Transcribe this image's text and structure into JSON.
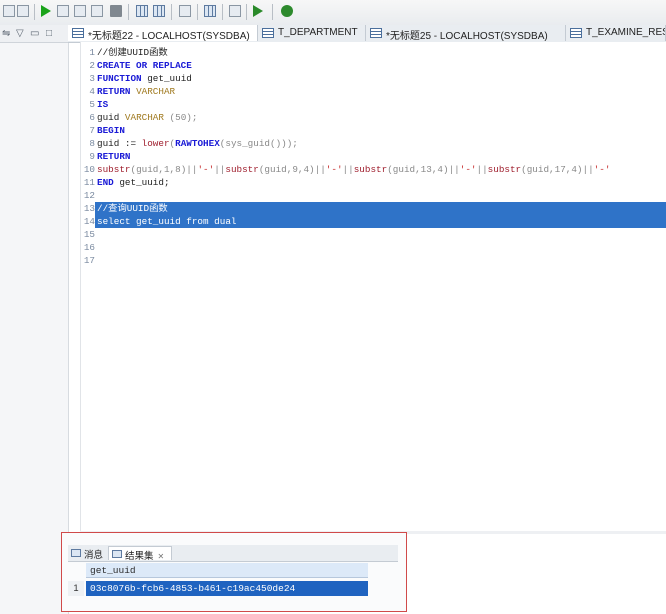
{
  "tabs": [
    {
      "label": "*无标题22 - LOCALHOST(SYSDBA)",
      "active": true
    },
    {
      "label": "T_DEPARTMENT",
      "active": false
    },
    {
      "label": "*无标题25 - LOCALHOST(SYSDBA)",
      "active": false
    },
    {
      "label": "T_EXAMINE_RESULT",
      "active": false
    }
  ],
  "editor": {
    "line_numbers": [
      "1",
      "2",
      "3",
      "4",
      "5",
      "6",
      "7",
      "8",
      "9",
      "10",
      "11",
      "12",
      "13",
      "14",
      "15",
      "16",
      "17"
    ],
    "lines": [
      [
        {
          "t": "//创建UUID函数",
          "c": "id"
        }
      ],
      [
        {
          "t": "CREATE OR REPLACE",
          "c": "kw"
        }
      ],
      [
        {
          "t": "FUNCTION",
          "c": "kw"
        },
        {
          "t": " get_uuid",
          "c": "id"
        }
      ],
      [
        {
          "t": "RETURN",
          "c": "kw"
        },
        {
          "t": " VARCHAR",
          "c": "ty"
        }
      ],
      [
        {
          "t": "IS",
          "c": "kw"
        }
      ],
      [
        {
          "t": "guid ",
          "c": "id"
        },
        {
          "t": "VARCHAR",
          "c": "ty"
        },
        {
          "t": " (50);",
          "c": "pu"
        }
      ],
      [
        {
          "t": "BEGIN",
          "c": "kw"
        }
      ],
      [
        {
          "t": "guid := ",
          "c": "id"
        },
        {
          "t": "lower",
          "c": "fn"
        },
        {
          "t": "(",
          "c": "pu"
        },
        {
          "t": "RAWTOHEX",
          "c": "kw"
        },
        {
          "t": "(sys_guid()));",
          "c": "pu"
        }
      ],
      [
        {
          "t": "RETURN",
          "c": "kw"
        }
      ],
      [
        {
          "t": "substr",
          "c": "fn"
        },
        {
          "t": "(guid,1,8)||",
          "c": "pu"
        },
        {
          "t": "'-'",
          "c": "st"
        },
        {
          "t": "||",
          "c": "pu"
        },
        {
          "t": "substr",
          "c": "fn"
        },
        {
          "t": "(guid,9,4)||",
          "c": "pu"
        },
        {
          "t": "'-'",
          "c": "st"
        },
        {
          "t": "||",
          "c": "pu"
        },
        {
          "t": "substr",
          "c": "fn"
        },
        {
          "t": "(guid,13,4)||",
          "c": "pu"
        },
        {
          "t": "'-'",
          "c": "st"
        },
        {
          "t": "||",
          "c": "pu"
        },
        {
          "t": "substr",
          "c": "fn"
        },
        {
          "t": "(guid,17,4)||",
          "c": "pu"
        },
        {
          "t": "'-'",
          "c": "st"
        }
      ],
      [
        {
          "t": "END",
          "c": "kw"
        },
        {
          "t": " get_uuid;",
          "c": "id"
        }
      ],
      [],
      [
        {
          "t": "//查询UUID函数",
          "c": "sel"
        }
      ],
      [
        {
          "t": "select get_uuid from dual",
          "c": "sel"
        }
      ],
      [],
      [],
      []
    ]
  },
  "results": {
    "tabs": [
      {
        "label": "消息",
        "active": false
      },
      {
        "label": "结果集",
        "active": true
      }
    ],
    "column": "get_uuid",
    "row_number": "1",
    "value": "03c8076b-fcb6-4853-b461-c19ac450de24"
  },
  "colors": {
    "selection": "#2f73c8",
    "result_highlight": "#1f63c0",
    "annotation_box": "#d04a4a",
    "keyword": "#1a1ad6"
  }
}
